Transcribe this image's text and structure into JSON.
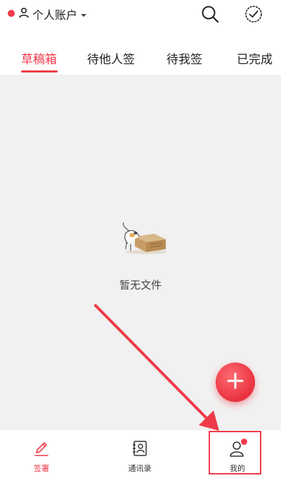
{
  "header": {
    "account_label": "个人账户",
    "icons": [
      "account-person-icon",
      "dropdown-caret-icon",
      "search-icon",
      "check-circle-icon"
    ],
    "accent_color": "#ee3b4a"
  },
  "tabs": [
    {
      "label": "草稿箱",
      "active": true
    },
    {
      "label": "待他人签",
      "active": false
    },
    {
      "label": "待我签",
      "active": false
    },
    {
      "label": "已完成",
      "active": false
    }
  ],
  "main": {
    "empty_text": "暂无文件",
    "fab_icon": "plus-icon"
  },
  "bottom_nav": [
    {
      "label": "签署",
      "icon": "pen-icon",
      "active": true
    },
    {
      "label": "通讯录",
      "icon": "contacts-icon",
      "active": false
    },
    {
      "label": "我的",
      "icon": "profile-icon",
      "active": false,
      "badge": true
    }
  ]
}
